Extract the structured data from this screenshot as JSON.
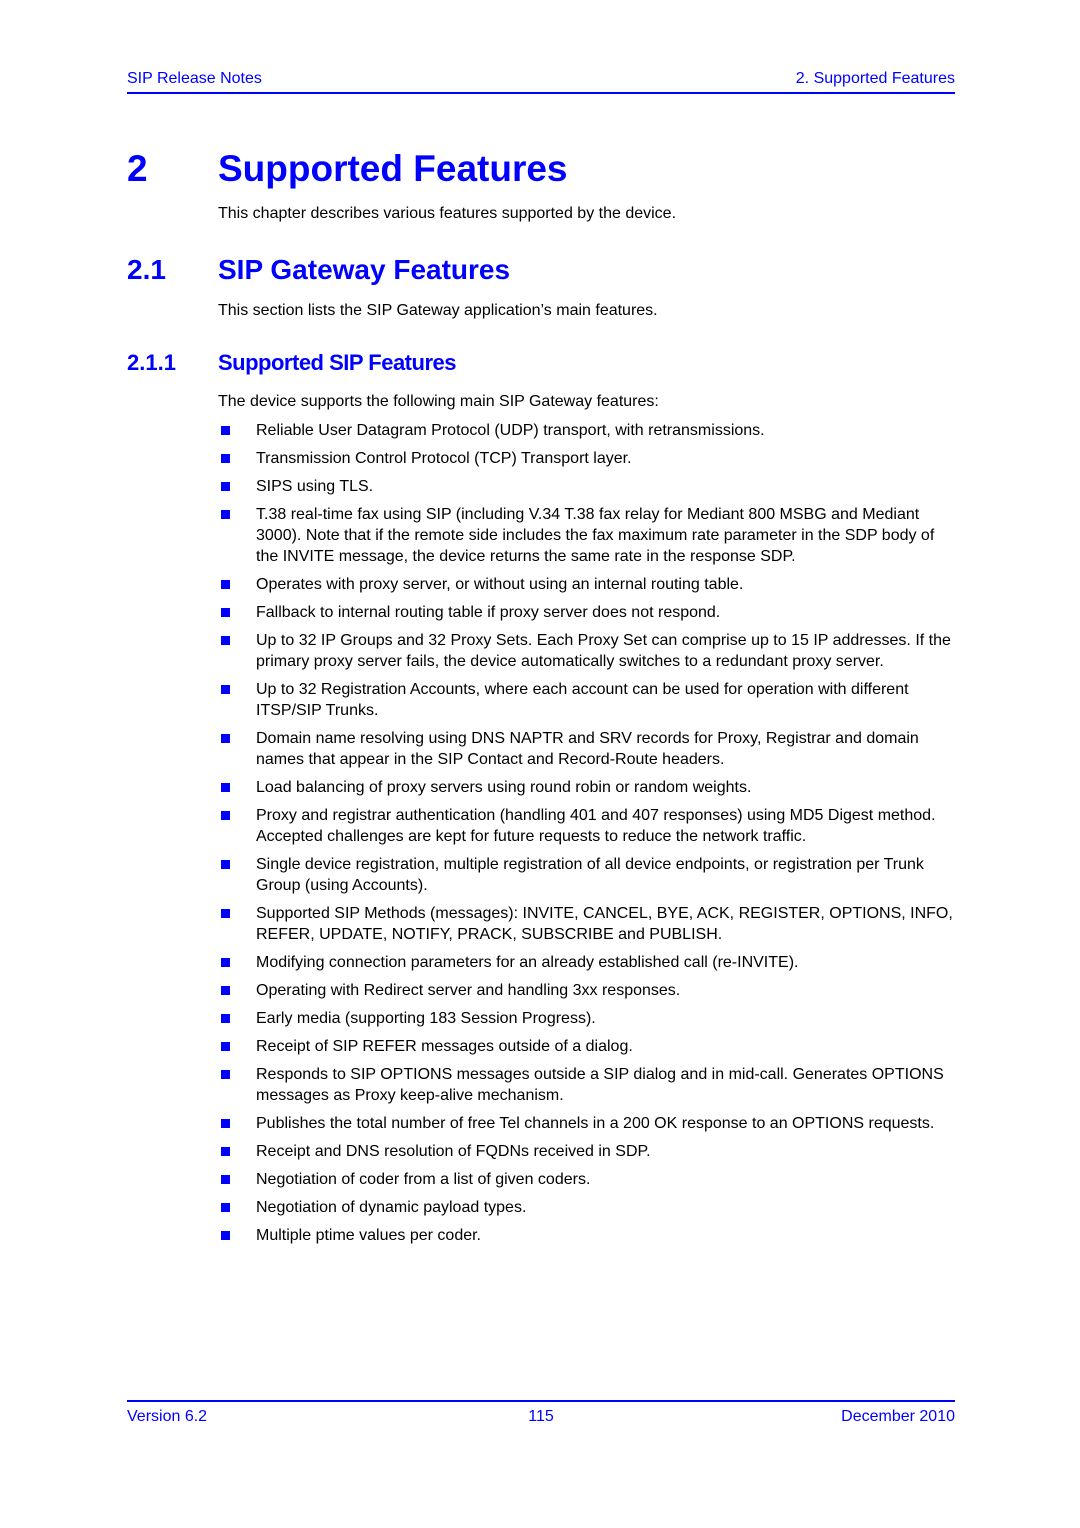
{
  "header": {
    "left": "SIP Release Notes",
    "right": "2. Supported Features"
  },
  "chapter": {
    "number": "2",
    "title": "Supported Features",
    "intro": "This chapter describes various features supported by the device."
  },
  "section": {
    "number": "2.1",
    "title": "SIP Gateway Features",
    "intro": "This section lists the SIP Gateway application’s main features."
  },
  "subsection": {
    "number": "2.1.1",
    "title": "Supported SIP Features",
    "intro": "The device supports the following main SIP Gateway features:",
    "items": [
      "Reliable User Datagram Protocol (UDP) transport, with retransmissions.",
      "Transmission Control Protocol (TCP) Transport layer.",
      "SIPS using TLS.",
      "T.38 real-time fax using SIP (including V.34 T.38 fax relay for Mediant 800 MSBG and Mediant 3000). Note that if the remote side includes the fax maximum rate parameter in the SDP body of the INVITE message, the device returns the same rate in the response SDP.",
      "Operates with proxy server, or without using an internal routing table.",
      "Fallback to internal routing table if proxy server does not respond.",
      "Up to 32 IP Groups and 32 Proxy Sets. Each Proxy Set can comprise up to 15 IP addresses. If the primary proxy server fails, the device automatically switches to a redundant proxy server.",
      "Up to 32 Registration Accounts, where each account can be used for operation with different ITSP/SIP Trunks.",
      "Domain name resolving using DNS NAPTR and SRV records for Proxy, Registrar and domain names that appear in the SIP Contact and Record-Route headers.",
      "Load balancing of proxy servers using round robin or random weights.",
      "Proxy and registrar authentication (handling 401 and 407 responses) using MD5 Digest method. Accepted challenges are kept for future requests to reduce the network traffic.",
      "Single device registration, multiple registration of all device endpoints, or registration per Trunk Group (using Accounts).",
      "Supported SIP Methods (messages): INVITE, CANCEL, BYE, ACK, REGISTER, OPTIONS, INFO, REFER, UPDATE, NOTIFY, PRACK, SUBSCRIBE and PUBLISH.",
      "Modifying connection parameters for an already established call (re-INVITE).",
      "Operating with Redirect server and handling 3xx responses.",
      "Early media (supporting 183 Session Progress).",
      "Receipt of SIP REFER messages outside of a dialog.",
      "Responds to SIP OPTIONS messages outside a SIP dialog and in mid-call. Generates OPTIONS messages as Proxy keep-alive mechanism.",
      "Publishes the total number of free Tel channels in a 200 OK response to an OPTIONS requests.",
      "Receipt and DNS resolution of FQDNs received in SDP.",
      "Negotiation of coder from a list of given coders.",
      "Negotiation of dynamic payload types.",
      "Multiple ptime values per coder."
    ]
  },
  "footer": {
    "left": "Version 6.2",
    "center": "115",
    "right": "December 2010"
  },
  "colors": {
    "accent": "#0000ff",
    "text": "#000000"
  }
}
